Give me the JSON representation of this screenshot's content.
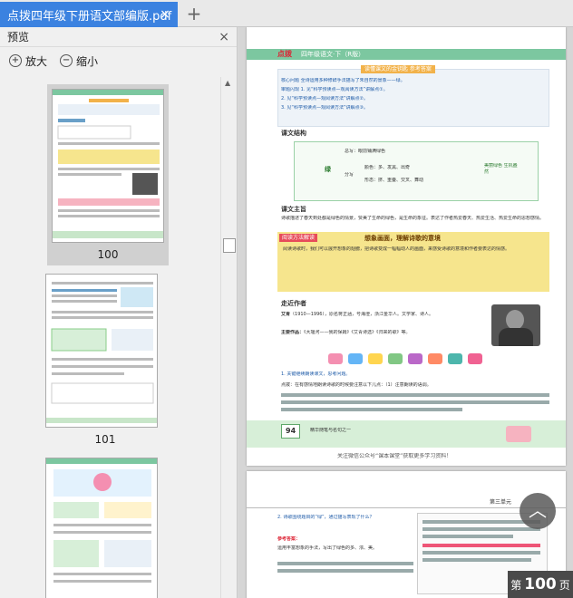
{
  "tab": {
    "title": "点拨四年级下册语文部编版.pdf",
    "close": "×",
    "add": "+"
  },
  "panel": {
    "title": "预览",
    "close": "×",
    "zoom_in": "放大",
    "zoom_out": "缩小",
    "thumbnails": [
      {
        "number": "100",
        "selected": true
      },
      {
        "number": "101",
        "selected": false
      },
      {
        "number": "",
        "selected": false
      }
    ]
  },
  "page1": {
    "header": "四年级语文·下（R版）",
    "brand": "点拨",
    "box_title": "读懂课文的金钥匙 参考答案",
    "intro_lines": [
      "核心问题 全诗运用多种修辞手法描写了朱自然的景象——绿。",
      "审题闪现 1. 见“科学预读点—观阅读方法”讲解点①。",
      "2. 见“科学预读点—观阅读方法”讲解点②。",
      "3. 见“科学预读点—观阅读方法”讲解点③。"
    ],
    "section1": "课文结构",
    "structure": {
      "root": "绿",
      "branch1": "总写：眼前铺满绿色",
      "branch2": "分写",
      "sub1": "颜色：多、发黑、出奇",
      "sub2": "形态：挤、重叠、交叉、舞动",
      "result": "美丽绿色 生机盎然"
    },
    "section2": "课文主旨",
    "theme": "诗歌描述了春天到处都是绿色的情景，赞美了生命的绿色，是生命的象征。表达了作者热爱春天、热爱生活、热爱生命的思想感情。",
    "reading_tag": "阅读方法解读",
    "reading_title": "想象画面，理解诗歌的意境",
    "reading_text": "阅读诗歌时，我们可以展开想象的翅膀，把诗歌变成一幅幅动人的画面，来感受诗歌的意境和作者要表达的情感。",
    "section3": "走近作者",
    "author_name": "艾青",
    "author_info": "（1910—1996），原名蒋正涵，号海澄，浙江金华人。文学家、诗人。",
    "author_works_label": "主要作品：",
    "author_works": "《大堰河——我的保姆》《艾青诗选》《归来的歌》等。",
    "exercise_head": "1. 关键继续朗读课文，思考问题。",
    "exercise_point": "点拨：在有感情地朗读诗歌的时候要注意以下几点：（1）注意朗读的语调。",
    "page_no": "94",
    "footer_note": "精华随笔与名句之一",
    "footer_line": "关注微信公众号“课本课堂”获取更多学习资料！"
  },
  "page2": {
    "unit": "第三单元",
    "q2": "2. 诗歌围绕题目的“绿”，通过描写表现了什么？",
    "answer_label": "参考答案：",
    "answer": "运用丰富想象的手法，写出了绿色的多、浓、美。"
  },
  "page_indicator": {
    "prefix": "第",
    "number": "100",
    "suffix": "页"
  },
  "colors": {
    "tab_blue": "#3b82e0",
    "green_band": "#5fa86a",
    "yellow_band": "#f6e58d"
  },
  "icons": {
    "zoom_in": "zoom-in-icon",
    "zoom_out": "zoom-out-icon",
    "scroll_top": "chevron-up-icon"
  }
}
